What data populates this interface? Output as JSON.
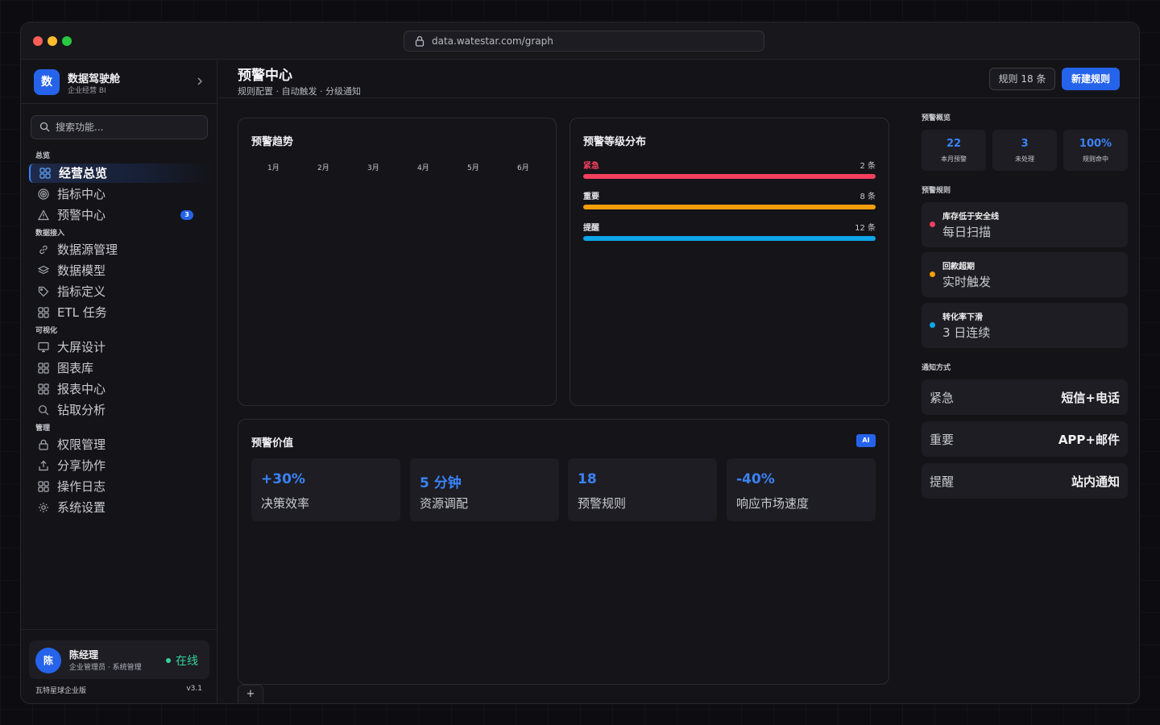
{
  "browser": {
    "url": "data.watestar.com/graph"
  },
  "brand": {
    "logo": "数",
    "name": "数据驾驶舱",
    "subtitle": "企业经营 BI"
  },
  "search": {
    "placeholder": "搜索功能..."
  },
  "sidebar": {
    "sections": [
      {
        "label": "总览",
        "items": [
          {
            "label": "经营总览",
            "icon": "grid-icon",
            "active": true
          },
          {
            "label": "指标中心",
            "icon": "target-icon"
          },
          {
            "label": "预警中心",
            "icon": "warning-icon",
            "badge": "3"
          }
        ]
      },
      {
        "label": "数据接入",
        "items": [
          {
            "label": "数据源管理",
            "icon": "link-icon"
          },
          {
            "label": "数据模型",
            "icon": "layers-icon"
          },
          {
            "label": "指标定义",
            "icon": "tag-icon"
          },
          {
            "label": "ETL 任务",
            "icon": "grid-icon"
          }
        ]
      },
      {
        "label": "可视化",
        "items": [
          {
            "label": "大屏设计",
            "icon": "monitor-icon"
          },
          {
            "label": "图表库",
            "icon": "grid-icon"
          },
          {
            "label": "报表中心",
            "icon": "grid-icon"
          },
          {
            "label": "钻取分析",
            "icon": "search-icon"
          }
        ]
      },
      {
        "label": "管理",
        "items": [
          {
            "label": "权限管理",
            "icon": "lock-icon"
          },
          {
            "label": "分享协作",
            "icon": "share-icon"
          },
          {
            "label": "操作日志",
            "icon": "grid-icon"
          },
          {
            "label": "系统设置",
            "icon": "gear-icon"
          }
        ]
      }
    ]
  },
  "user": {
    "avatar": "陈",
    "name": "陈经理",
    "role": "企业管理员 · 系统管理",
    "status": "在线"
  },
  "footer": {
    "edition": "瓦特星球企业版",
    "version": "v3.1"
  },
  "header": {
    "title": "预警中心",
    "subtitle": "规则配置 · 自动触发 · 分级通知",
    "rules_button": "规则 18 条",
    "new_button": "新建规则"
  },
  "trend": {
    "title": "预警趋势",
    "months": [
      "1月",
      "2月",
      "3月",
      "4月",
      "5月",
      "6月"
    ]
  },
  "levels": {
    "title": "预警等级分布",
    "items": [
      {
        "label": "紧急",
        "count": "2 条",
        "color": "#f43f5e"
      },
      {
        "label": "重要",
        "count": "8 条",
        "color": "#f59e0b"
      },
      {
        "label": "提醒",
        "count": "12 条",
        "color": "#0ea5e9"
      }
    ]
  },
  "value": {
    "title": "预警价值",
    "badge": "AI",
    "cards": [
      {
        "num": "+30%",
        "label": "决策效率"
      },
      {
        "num": "5 分钟",
        "label": "资源调配"
      },
      {
        "num": "18",
        "label": "预警规则"
      },
      {
        "num": "-40%",
        "label": "响应市场速度"
      }
    ]
  },
  "add_tab": "+",
  "overview": {
    "label": "预警概览",
    "stats": [
      {
        "num": "22",
        "label": "本月预警"
      },
      {
        "num": "3",
        "label": "未处理"
      },
      {
        "num": "100%",
        "label": "规则命中"
      }
    ]
  },
  "rules": {
    "label": "预警规则",
    "items": [
      {
        "name": "库存低于安全线",
        "desc": "每日扫描",
        "color": "#f43f5e"
      },
      {
        "name": "回款超期",
        "desc": "实时触发",
        "color": "#f59e0b"
      },
      {
        "name": "转化率下滑",
        "desc": "3 日连续",
        "color": "#0ea5e9"
      }
    ]
  },
  "notify": {
    "label": "通知方式",
    "items": [
      {
        "level": "紧急",
        "way": "短信+电话"
      },
      {
        "level": "重要",
        "way": "APP+邮件"
      },
      {
        "level": "提醒",
        "way": "站内通知"
      }
    ]
  }
}
